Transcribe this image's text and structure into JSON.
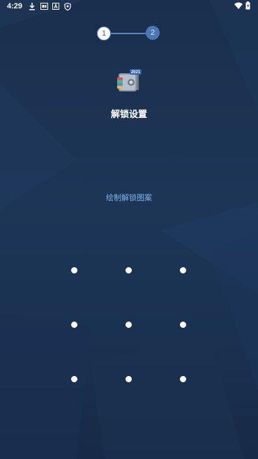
{
  "status_bar": {
    "time": "4:29",
    "left_icons": [
      "download-icon",
      "notification-icon",
      "a-icon",
      "shield-icon"
    ],
    "right_icons": [
      "wifi-icon",
      "battery-icon"
    ]
  },
  "steps": [
    {
      "number": "1",
      "state": "current"
    },
    {
      "number": "2",
      "state": "upcoming"
    }
  ],
  "app_icon": {
    "badge": "2021"
  },
  "title": "解锁设置",
  "hint": "绘制解锁图案",
  "colors": {
    "background": "#1d3657",
    "accent": "#4d76b8",
    "hint_text": "#7fb1f0"
  }
}
